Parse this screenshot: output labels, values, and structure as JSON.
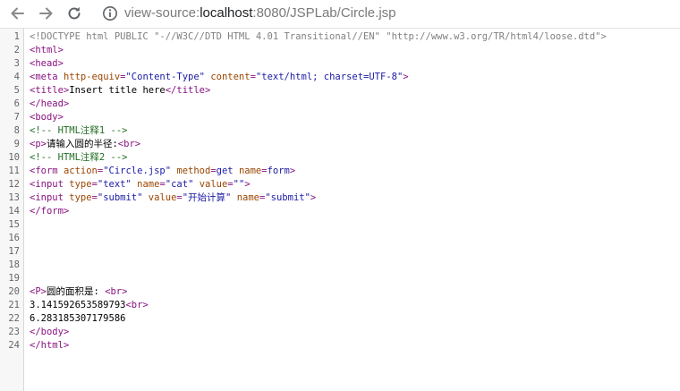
{
  "browser": {
    "url_scheme": "view-source:",
    "url_host": "localhost",
    "url_path": ":8080/JSPLab/Circle.jsp",
    "icons": [
      "back-arrow-icon",
      "forward-arrow-icon",
      "reload-icon",
      "info-icon"
    ]
  },
  "source_lines": [
    [
      [
        "doctype",
        "<!DOCTYPE html PUBLIC \"-//W3C//DTD HTML 4.01 Transitional//EN\" \"http://www.w3.org/TR/html4/loose.dtd\">"
      ]
    ],
    [
      [
        "tag",
        "<html>"
      ]
    ],
    [
      [
        "tag",
        "<head>"
      ]
    ],
    [
      [
        "tag",
        "<meta "
      ],
      [
        "attr",
        "http-equiv"
      ],
      [
        "tag",
        "="
      ],
      [
        "val",
        "\"Content-Type\""
      ],
      [
        "tag",
        " "
      ],
      [
        "attr",
        "content"
      ],
      [
        "tag",
        "="
      ],
      [
        "val",
        "\"text/html; charset=UTF-8\""
      ],
      [
        "tag",
        ">"
      ]
    ],
    [
      [
        "tag",
        "<title>"
      ],
      [
        "text",
        "Insert title here"
      ],
      [
        "tag",
        "</title>"
      ]
    ],
    [
      [
        "tag",
        "</head>"
      ]
    ],
    [
      [
        "tag",
        "<body>"
      ]
    ],
    [
      [
        "comment",
        "<!-- HTML注释1 -->"
      ]
    ],
    [
      [
        "tag",
        "<p>"
      ],
      [
        "text",
        "请输入圆的半径:"
      ],
      [
        "tag",
        "<br>"
      ]
    ],
    [
      [
        "comment",
        "<!-- HTML注释2 -->"
      ]
    ],
    [
      [
        "tag",
        "<form "
      ],
      [
        "attr",
        "action"
      ],
      [
        "tag",
        "="
      ],
      [
        "val",
        "\"Circle.jsp\""
      ],
      [
        "tag",
        " "
      ],
      [
        "attr",
        "method"
      ],
      [
        "tag",
        "="
      ],
      [
        "val",
        "get"
      ],
      [
        "tag",
        " "
      ],
      [
        "attr",
        "name"
      ],
      [
        "tag",
        "="
      ],
      [
        "val",
        "form"
      ],
      [
        "tag",
        ">"
      ]
    ],
    [
      [
        "tag",
        "<input "
      ],
      [
        "attr",
        "type"
      ],
      [
        "tag",
        "="
      ],
      [
        "val",
        "\"text\""
      ],
      [
        "tag",
        " "
      ],
      [
        "attr",
        "name"
      ],
      [
        "tag",
        "="
      ],
      [
        "val",
        "\"cat\""
      ],
      [
        "tag",
        " "
      ],
      [
        "attr",
        "value"
      ],
      [
        "tag",
        "="
      ],
      [
        "val",
        "\"\""
      ],
      [
        "tag",
        ">"
      ]
    ],
    [
      [
        "tag",
        "<input "
      ],
      [
        "attr",
        "type"
      ],
      [
        "tag",
        "="
      ],
      [
        "val",
        "\"submit\""
      ],
      [
        "tag",
        " "
      ],
      [
        "attr",
        "value"
      ],
      [
        "tag",
        "="
      ],
      [
        "val",
        "\"开始计算\""
      ],
      [
        "tag",
        " "
      ],
      [
        "attr",
        "name"
      ],
      [
        "tag",
        "="
      ],
      [
        "val",
        "\"submit\""
      ],
      [
        "tag",
        ">"
      ]
    ],
    [
      [
        "tag",
        "</form>"
      ]
    ],
    [],
    [],
    [],
    [],
    [],
    [
      [
        "tag",
        "<P>"
      ],
      [
        "text",
        "圆的面积是: "
      ],
      [
        "tag",
        "<br>"
      ]
    ],
    [
      [
        "text",
        "3.141592653589793"
      ],
      [
        "tag",
        "<br>"
      ]
    ],
    [
      [
        "text",
        "6.283185307179586"
      ]
    ],
    [
      [
        "tag",
        "</body>"
      ]
    ],
    [
      [
        "tag",
        "</html>"
      ]
    ]
  ]
}
